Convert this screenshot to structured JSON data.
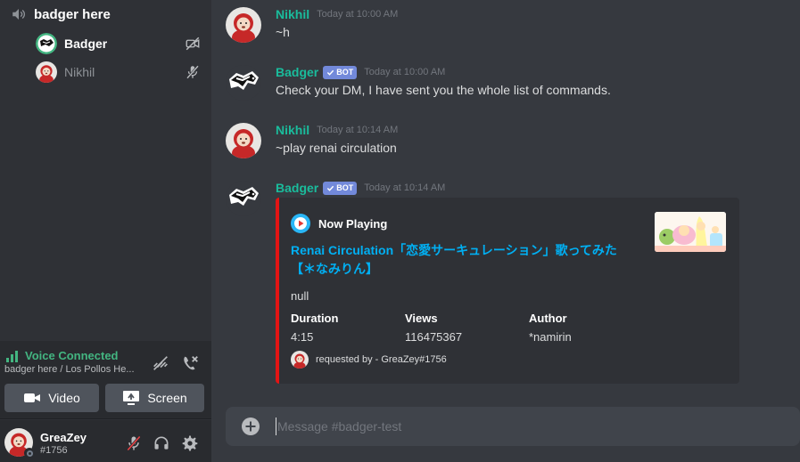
{
  "sidebar": {
    "channel": {
      "name": "badger here",
      "icon": "speaker-icon"
    },
    "voice_users": [
      {
        "name": "Badger",
        "icon": "video-off-icon"
      },
      {
        "name": "Nikhil",
        "icon": "mic-off-icon"
      }
    ],
    "voice_panel": {
      "status": "Voice Connected",
      "location": "badger here / Los Pollos He...",
      "video_label": "Video",
      "screen_label": "Screen"
    },
    "user_panel": {
      "name": "GreaZey",
      "tag": "#1756"
    }
  },
  "messages": [
    {
      "author": "Nikhil",
      "bot": false,
      "timestamp": "Today at 10:00 AM",
      "text": "~h"
    },
    {
      "author": "Badger",
      "bot": true,
      "bot_label": "BOT",
      "timestamp": "Today at 10:00 AM",
      "text": "Check your DM, I have sent you the whole list of commands."
    },
    {
      "author": "Nikhil",
      "bot": false,
      "timestamp": "Today at 10:14 AM",
      "text": "~play renai circulation"
    },
    {
      "author": "Badger",
      "bot": true,
      "bot_label": "BOT",
      "timestamp": "Today at 10:14 AM",
      "text": ""
    }
  ],
  "embed": {
    "accent": "#e31414",
    "author": "Now Playing",
    "title": "Renai Circulation「恋愛サーキュレーション」歌ってみた【＊なみりん】",
    "description": "null",
    "fields": [
      {
        "name": "Duration",
        "value": "4:15"
      },
      {
        "name": "Views",
        "value": "116475367"
      },
      {
        "name": "Author",
        "value": "*namirin"
      }
    ],
    "footer": "requested by - GreaZey#1756"
  },
  "composer": {
    "placeholder": "Message #badger-test"
  },
  "colors": {
    "chat_bg": "#36393f",
    "sidebar_bg": "#2f3136",
    "panel_bg": "#292b2f",
    "author_color": "#1abc9c",
    "link": "#00b0f4",
    "connected": "#43b581",
    "bot_badge": "#7289da"
  }
}
